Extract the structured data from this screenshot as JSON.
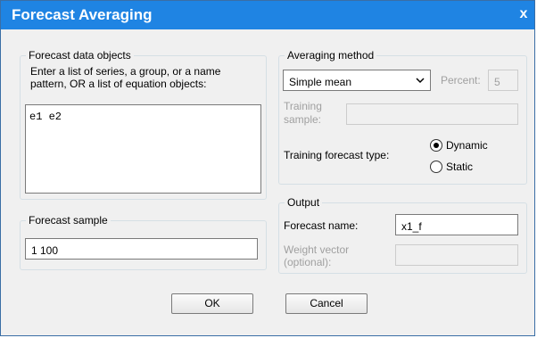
{
  "window": {
    "title": "Forecast Averaging",
    "close_glyph": "x"
  },
  "forecast_data_objects": {
    "legend": "Forecast data objects",
    "instructions_line1": "Enter a list of series, a group, or a name",
    "instructions_line2": "pattern, OR a list of equation objects:",
    "value": "e1 e2"
  },
  "forecast_sample": {
    "legend": "Forecast sample",
    "value": "1 100"
  },
  "averaging_method": {
    "legend": "Averaging method",
    "method": "Simple mean",
    "percent_label": "Percent:",
    "percent_value": "5",
    "training_sample_label_line1": "Training",
    "training_sample_label_line2": "sample:",
    "training_sample_value": "",
    "training_forecast_type_label": "Training forecast type:",
    "options": [
      "Dynamic",
      "Static"
    ],
    "selected": "Dynamic"
  },
  "output": {
    "legend": "Output",
    "forecast_name_label": "Forecast name:",
    "forecast_name_value": "x1_f",
    "weight_vector_label_line1": "Weight vector",
    "weight_vector_label_line2": "(optional):",
    "weight_vector_value": ""
  },
  "buttons": {
    "ok": "OK",
    "cancel": "Cancel"
  },
  "icons": {
    "dropdown": "chevron-down-icon",
    "close": "close-icon"
  }
}
